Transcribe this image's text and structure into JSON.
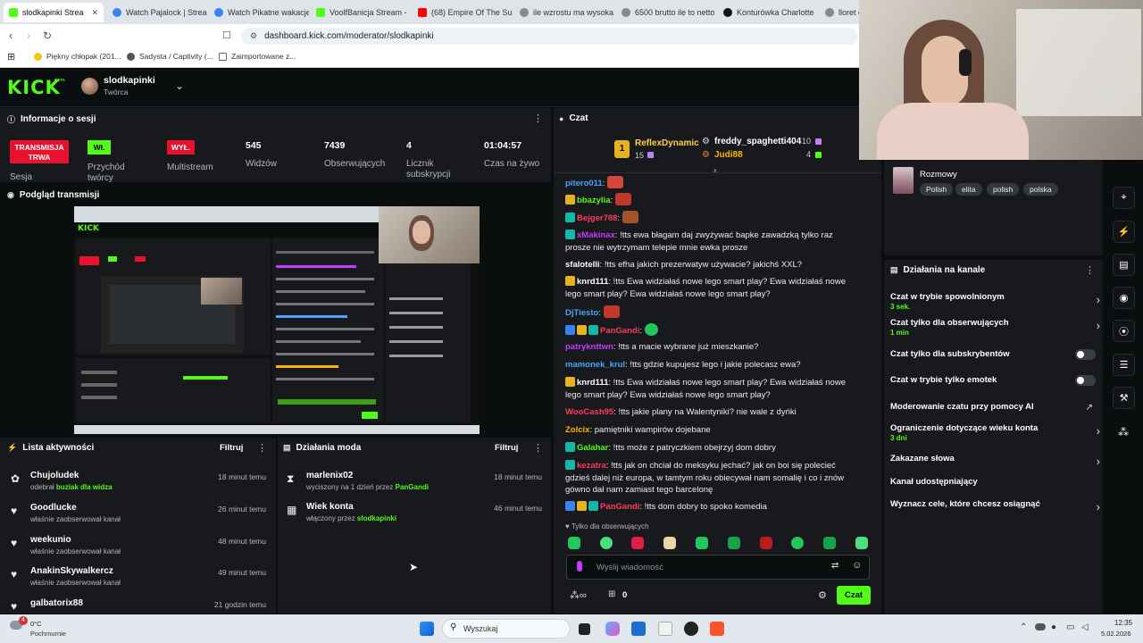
{
  "browser": {
    "tabs": [
      {
        "label": "slodkapinki Strea",
        "active": true,
        "color": "#53fc18"
      },
      {
        "label": "Watch Pajalock | Strea",
        "color": "#3b82f6"
      },
      {
        "label": "Watch Pikatne wakacje",
        "color": "#3b82f6"
      },
      {
        "label": "VoolfBanicja Stream -",
        "color": "#53fc18"
      },
      {
        "label": "(68) Empire Of The Sun",
        "color": "#ff0000"
      },
      {
        "label": "ile wzrostu ma wysoka",
        "color": "#888888"
      },
      {
        "label": "6500 brutto ile to netto",
        "color": "#888888"
      },
      {
        "label": "Konturówka Charlotte",
        "color": "#111111"
      },
      {
        "label": "lloret d",
        "color": "#888888"
      }
    ],
    "url": "dashboard.kick.com/moderator/slodkapinki",
    "bookmarks": [
      "Piękny chłopak (201...",
      "Sadysta / Captivity (...",
      "Zaimportowane z..."
    ]
  },
  "header": {
    "logo": "KICK",
    "beta": "BETA",
    "channel_name": "slodkapinki",
    "channel_role": "Twórca"
  },
  "session": {
    "title": "Informacje o sesji",
    "live_badge": "TRANSMISJA TRWA",
    "live_label": "Sesja",
    "pass_badge": "Wł.",
    "pass_label": "Przychód twórcy",
    "multi_badge": "WYŁ.",
    "multi_label": "Multistream",
    "viewers": "545",
    "viewers_label": "Widzów",
    "followers": "7439",
    "followers_label": "Obserwujących",
    "subs": "4",
    "subs_label": "Licznik subskrypcji",
    "time": "01:04:57",
    "time_label": "Czas na żywo"
  },
  "preview": {
    "title": "Podgląd transmisji"
  },
  "activity": {
    "title": "Lista aktywności",
    "filter": "Filtruj",
    "items": [
      {
        "name": "Chujoludek",
        "sub_prefix": "odebrał ",
        "sub_hl": "buziak dla widza",
        "time": "18 minut temu",
        "icon": "⚙"
      },
      {
        "name": "Goodlucke",
        "sub_prefix": "właśnie zaobserwował kanał",
        "sub_hl": "",
        "time": "26 minut temu",
        "icon": "♥"
      },
      {
        "name": "weekunio",
        "sub_prefix": "właśnie zaobserwował kanał",
        "sub_hl": "",
        "time": "48 minut temu",
        "icon": "♥"
      },
      {
        "name": "AnakinSkywalkercz",
        "sub_prefix": "właśnie zaobserwował kanał",
        "sub_hl": "",
        "time": "49 minut temu",
        "icon": "♥"
      },
      {
        "name": "galbatorix88",
        "sub_prefix": "",
        "sub_hl": "",
        "time": "21 godzin temu",
        "icon": "♥"
      }
    ]
  },
  "modactions": {
    "title": "Działania moda",
    "filter": "Filtruj",
    "items": [
      {
        "name": "marlenix02",
        "sub_prefix": "wyciszony na 1 dzień przez ",
        "sub_hl": "PanGandi",
        "time": "18 minut temu"
      },
      {
        "name": "Wiek konta",
        "sub_prefix": "włączony przez ",
        "sub_hl": "slodkapinki",
        "time": "46 minut temu"
      }
    ]
  },
  "chat": {
    "title": "Czat",
    "top1_name": "ReflexDynamic",
    "top1_count": "15",
    "top2_name": "freddy_spaghetti404",
    "top2_count": "10",
    "top3_name": "Judi88",
    "top3_count": "4",
    "messages": [
      {
        "user": "pitero011",
        "color": "#4aa3ff",
        "text": ""
      },
      {
        "user": "bbazylia",
        "color": "#53fc18",
        "text": ""
      },
      {
        "user": "Bejger788",
        "color": "#ff3b5c",
        "text": ""
      },
      {
        "user": "xMakinax",
        "color": "#c33cff",
        "text": "!tts ewa błagam daj zwyżywać bapke zawadzką tylko raz prosze nie wytrzymam telepie mnie ewka prosze"
      },
      {
        "user": "sfalotelli",
        "color": "#ffffff",
        "text": "!tts efha jakich prezerwatyw używacie? jakichś XXL?"
      },
      {
        "user": "knrd111",
        "color": "#ffffff",
        "text": "!tts Ewa widziałaś nowe lego smart play? Ewa widziałaś nowe lego smart play? Ewa widziałaś nowe lego smart play?"
      },
      {
        "user": "DjTiesto",
        "color": "#4aa3ff",
        "text": ""
      },
      {
        "user": "PanGandi",
        "color": "#ff3b5c",
        "text": ""
      },
      {
        "user": "patryknttwn",
        "color": "#c33cff",
        "text": "!tts a macie wybrane już mieszkanie?"
      },
      {
        "user": "mamonek_krul",
        "color": "#4aa3ff",
        "text": "!tts gdzie kupujesz lego i jakie polecasz ewa?"
      },
      {
        "user": "knrd111",
        "color": "#ffffff",
        "text": "!tts Ewa widziałaś nowe lego smart play? Ewa widziałaś nowe lego smart play? Ewa widziałaś nowe lego smart play?"
      },
      {
        "user": "WooCash95",
        "color": "#ff3b5c",
        "text": "!tts jakie plany na Walentyniki? nie wale z dyńki"
      },
      {
        "user": "Zolcix",
        "color": "#ffb400",
        "text": "pamiętniki wampirów dojebane"
      },
      {
        "user": "Galahar",
        "color": "#53fc18",
        "text": "!tts może z patryczkiem obejrzyj dom dobry"
      },
      {
        "user": "kezatra",
        "color": "#ff3b5c",
        "text": "!tts jak on chciał do meksyku jechać? jak on boi się polecieć gdzieś dalej niż europa, w tamtym roku obiecywał nam somalię i co i znów gówno dał nam zamiast tego barcelonę"
      },
      {
        "user": "PanGandi",
        "color": "#ff3b5c",
        "text": "!tts dom dobry to spoko komedia"
      }
    ],
    "followers_only": "Tylko dla obserwujących",
    "input_placeholder": "Wyślij wiadomość",
    "points": "0",
    "send_label": "Czat"
  },
  "stream_info": {
    "category": "Rozmowy",
    "tags": [
      "Polish",
      "elita",
      "polish",
      "polska"
    ]
  },
  "channel_actions": {
    "title": "Działania na kanale",
    "items": [
      {
        "title": "Czat w trybie spowolnionym",
        "sub": "3 sek.",
        "control": "chevron"
      },
      {
        "title": "Czat tylko dla obserwujących",
        "sub": "1 min",
        "control": "chevron"
      },
      {
        "title": "Czat tylko dla subskrybentów",
        "sub": "",
        "control": "toggle"
      },
      {
        "title": "Czat w trybie tylko emotek",
        "sub": "",
        "control": "toggle"
      },
      {
        "title": "Moderowanie czatu przy pomocy AI",
        "sub": "",
        "control": "external"
      },
      {
        "title": "Ograniczenie dotyczące wieku konta",
        "sub": "3 dni",
        "control": "chevron"
      },
      {
        "title": "Zakazane słowa",
        "sub": "",
        "control": "chevron"
      },
      {
        "title": "Kanał udostępniający",
        "sub": "",
        "control": "none"
      },
      {
        "title": "Wyznacz cele, które chcesz osiągnąć",
        "sub": "",
        "control": "chevron"
      }
    ]
  },
  "taskbar": {
    "weather_temp": "0°C",
    "weather_desc": "Pochmurnie",
    "weather_badge": "4",
    "search_placeholder": "Wyszukaj",
    "time": "12:35",
    "date": "5.02.2026"
  },
  "colors": {
    "accent": "#53fc18",
    "live": "#e9112e",
    "panel": "#18191c"
  }
}
